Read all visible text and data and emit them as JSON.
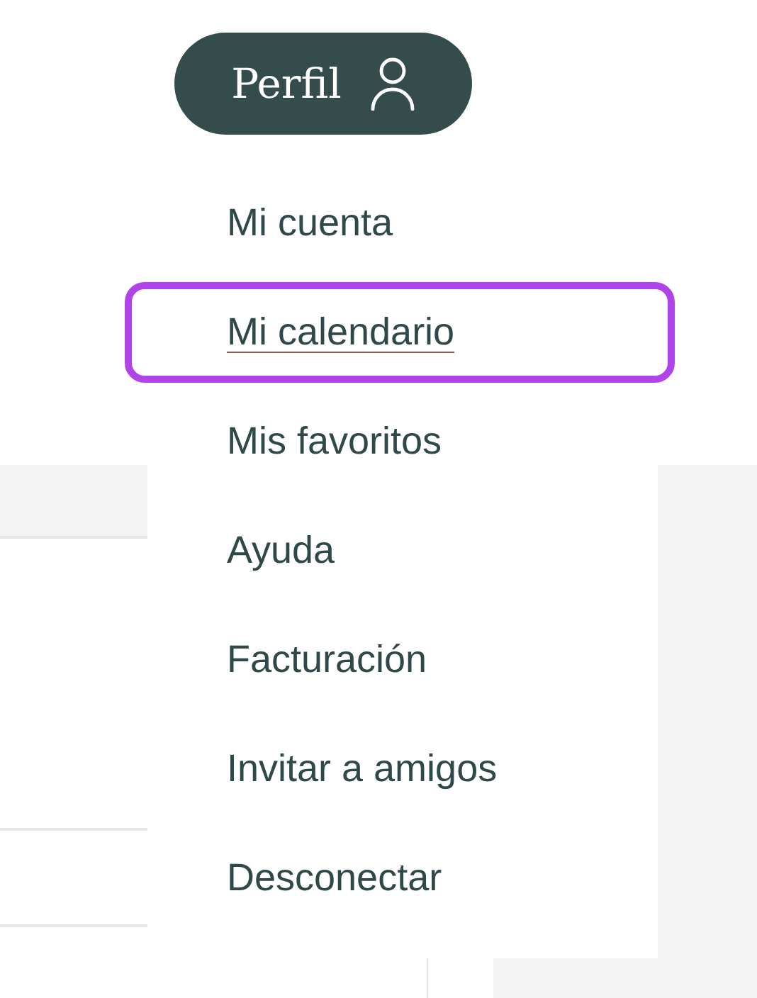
{
  "profile_button": {
    "label": "Perfil"
  },
  "menu": {
    "items": [
      {
        "label": "Mi cuenta",
        "selected": false
      },
      {
        "label": "Mi calendario",
        "selected": true
      },
      {
        "label": "Mis favoritos",
        "selected": false
      },
      {
        "label": "Ayuda",
        "selected": false
      },
      {
        "label": "Facturación",
        "selected": false
      },
      {
        "label": "Invitar a amigos",
        "selected": false
      },
      {
        "label": "Desconectar",
        "selected": false
      }
    ]
  }
}
